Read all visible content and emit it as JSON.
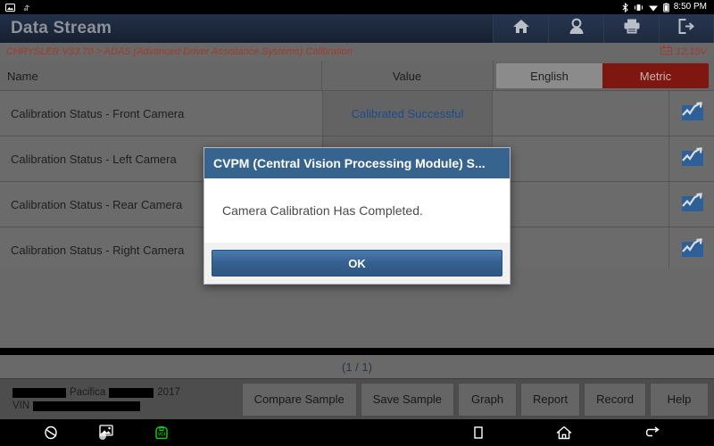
{
  "status_bar": {
    "time": "8:50 PM",
    "icons": [
      "bluetooth-icon",
      "vibrate-icon",
      "wifi-icon",
      "battery-icon"
    ]
  },
  "header": {
    "title": "Data Stream",
    "tools": [
      {
        "name": "home-button",
        "icon": "home-icon"
      },
      {
        "name": "user-button",
        "icon": "user-icon"
      },
      {
        "name": "print-button",
        "icon": "printer-icon"
      },
      {
        "name": "exit-button",
        "icon": "exit-icon"
      }
    ]
  },
  "breadcrumb": {
    "text": "CHRYSLER V33.70 > ADAS (Advanced Driver Assistance Systems) Calibration",
    "voltage": "12.15V"
  },
  "table": {
    "columns": {
      "name": "Name",
      "value": "Value"
    },
    "units": {
      "english": "English",
      "metric": "Metric",
      "selected": "Metric"
    },
    "rows": [
      {
        "name": "Calibration Status - Front Camera",
        "value": "Calibrated Successful",
        "unit": "",
        "graph": "chart-icon"
      },
      {
        "name": "Calibration Status - Left Camera",
        "value": "",
        "unit": "",
        "graph": "chart-icon"
      },
      {
        "name": "Calibration Status - Rear Camera",
        "value": "",
        "unit": "",
        "graph": "chart-icon"
      },
      {
        "name": "Calibration Status - Right Camera",
        "value": "",
        "unit": "",
        "graph": "chart-icon"
      }
    ]
  },
  "pager": {
    "text": "(1 / 1)"
  },
  "vehicle": {
    "model": "Pacifica",
    "year": "2017",
    "vin_label": "VIN",
    "redacted_make": true,
    "redacted_trim": true,
    "redacted_vin": true
  },
  "bottom_buttons": [
    {
      "name": "compare-sample-button",
      "label": "Compare Sample"
    },
    {
      "name": "save-sample-button",
      "label": "Save Sample"
    },
    {
      "name": "graph-button",
      "label": "Graph"
    },
    {
      "name": "report-button",
      "label": "Report"
    },
    {
      "name": "record-button",
      "label": "Record"
    },
    {
      "name": "help-button",
      "label": "Help"
    }
  ],
  "dialog": {
    "title": "CVPM (Central Vision Processing Module) S...",
    "message": "Camera Calibration Has Completed.",
    "ok_label": "OK"
  },
  "nav_bar": {
    "left": [
      "browser-icon",
      "screenshot-icon",
      "vci-icon"
    ],
    "right": [
      "recents-icon",
      "home-icon",
      "back-icon"
    ]
  },
  "colors": {
    "header_blue": "#1b273b",
    "breadcrumb_red": "#a33b2b",
    "metric_selected": "#7e1710",
    "value_blue": "#1b4b8f",
    "dialog_title_blue": "#36648f",
    "vci_green": "#16c216"
  }
}
